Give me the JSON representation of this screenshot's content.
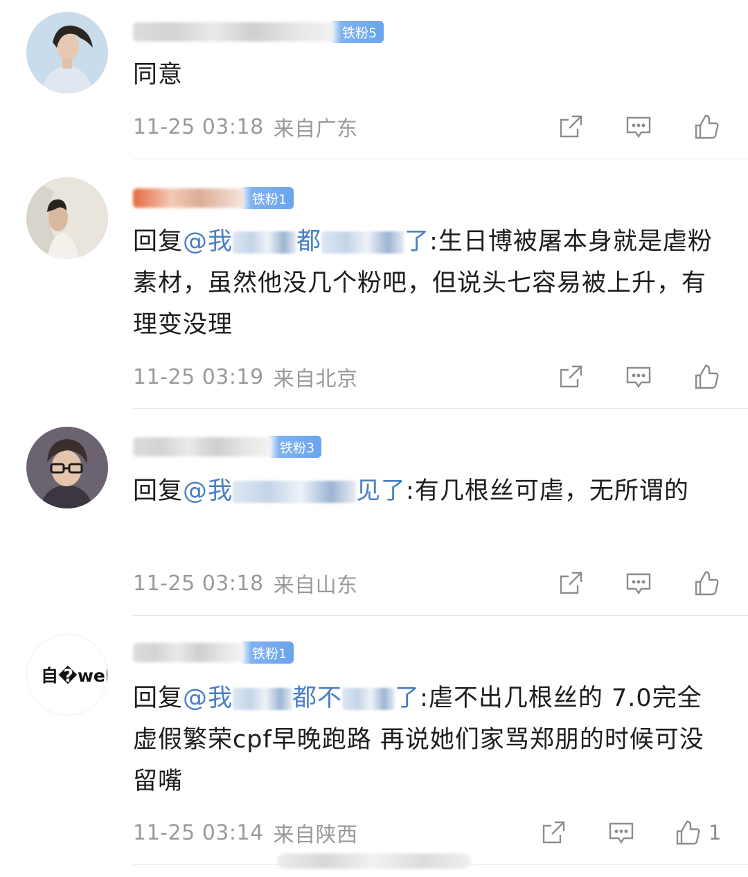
{
  "comments": [
    {
      "badge": "铁粉5",
      "text": "同意",
      "time": "11-25 03:18",
      "location": "来自广东",
      "like_count": ""
    },
    {
      "badge": "铁粉1",
      "reply_prefix": "回复",
      "mention_start": "@我",
      "mention_mid": "都",
      "mention_end": "了",
      "text": ":生日博被屠本身就是虐粉素材，虽然他没几个粉吧，但说头七容易被上升，有理变没理",
      "time": "11-25 03:19",
      "location": "来自北京",
      "like_count": ""
    },
    {
      "badge": "铁粉3",
      "reply_prefix": "回复",
      "mention_start": "@我",
      "mention_end": "见了",
      "text": ":有几根丝可虐，无所谓的",
      "time": "11-25 03:18",
      "location": "来自山东",
      "like_count": ""
    },
    {
      "avatar_text": "自�web怪",
      "badge": "铁粉1",
      "reply_prefix": "回复",
      "mention_start": "@我",
      "mention_mid": "都不",
      "mention_end": "了",
      "text": ":虐不出几根丝的 7.0完全虚假繁荣cpf早晚跑路 再说她们家骂郑朋的时候可没留嘴",
      "time": "11-25 03:14",
      "location": "来自陕西",
      "like_count": "1"
    }
  ],
  "icons": [
    "share-icon",
    "comment-icon",
    "like-icon"
  ],
  "colors": {
    "mention": "#4a7fc4",
    "badge": "#6aa4ee",
    "meta": "#9a9a9a"
  }
}
